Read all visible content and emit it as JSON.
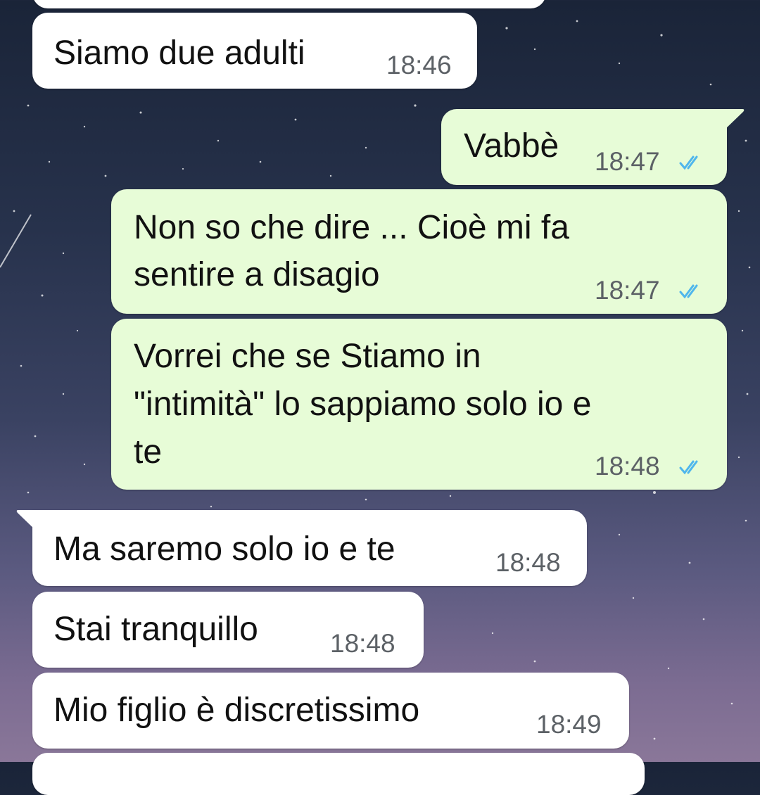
{
  "colors": {
    "incoming_bubble": "#ffffff",
    "outgoing_bubble": "#e7fcd7",
    "read_ticks": "#4fb6ec",
    "timestamp": "#5c6166"
  },
  "messages": [
    {
      "direction": "in",
      "text": "Siamo due adulti",
      "time": "18:46"
    },
    {
      "direction": "out",
      "text": "Vabbè",
      "time": "18:47",
      "status": "read-ticks-icon"
    },
    {
      "direction": "out",
      "lines": [
        "Non so che dire ... Cioè mi fa",
        "sentire a disagio"
      ],
      "time": "18:47",
      "status": "read-ticks-icon"
    },
    {
      "direction": "out",
      "lines": [
        "Vorrei che se Stiamo in",
        "\"intimità\" lo sappiamo solo io e",
        "te"
      ],
      "time": "18:48",
      "status": "read-ticks-icon"
    },
    {
      "direction": "in",
      "text": "Ma saremo solo io e te",
      "time": "18:48"
    },
    {
      "direction": "in",
      "text": "Stai tranquillo",
      "time": "18:48"
    },
    {
      "direction": "in",
      "text": "Mio figlio è discretissimo",
      "time": "18:49"
    }
  ]
}
